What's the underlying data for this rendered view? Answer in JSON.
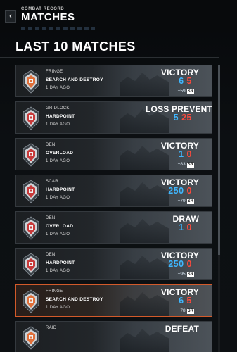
{
  "header": {
    "back_label": "‹",
    "breadcrumb": "COMBAT RECORD",
    "title": "MATCHES"
  },
  "section": {
    "title": "LAST 10 MATCHES"
  },
  "colors": {
    "blue_team": "#3fb7ff",
    "red_team": "#ff4a3d",
    "selection": "#d35a2a"
  },
  "matches": [
    {
      "map": "FRINGE",
      "mode": "SEARCH AND DESTROY",
      "time": "1 DAY AGO",
      "result": "VICTORY",
      "blue_score": "6",
      "red_score": "5",
      "sr_change": "+59",
      "sr_label": "SR",
      "emblem": "orange"
    },
    {
      "map": "GRIDLOCK",
      "mode": "HARDPOINT",
      "time": "1 DAY AGO",
      "result": "LOSS PREVENTED",
      "blue_score": "5",
      "red_score": "25",
      "sr_change": "",
      "sr_label": "",
      "emblem": "red"
    },
    {
      "map": "DEN",
      "mode": "OVERLOAD",
      "time": "1 DAY AGO",
      "result": "VICTORY",
      "blue_score": "1",
      "red_score": "0",
      "sr_change": "+83",
      "sr_label": "SR",
      "emblem": "red"
    },
    {
      "map": "SCAR",
      "mode": "HARDPOINT",
      "time": "1 DAY AGO",
      "result": "VICTORY",
      "blue_score": "250",
      "red_score": "0",
      "sr_change": "+79",
      "sr_label": "SR",
      "emblem": "red"
    },
    {
      "map": "DEN",
      "mode": "OVERLOAD",
      "time": "1 DAY AGO",
      "result": "DRAW",
      "blue_score": "1",
      "red_score": "0",
      "sr_change": "",
      "sr_label": "",
      "emblem": "red"
    },
    {
      "map": "DEN",
      "mode": "HARDPOINT",
      "time": "1 DAY AGO",
      "result": "VICTORY",
      "blue_score": "250",
      "red_score": "0",
      "sr_change": "+95",
      "sr_label": "SR",
      "emblem": "red"
    },
    {
      "map": "FRINGE",
      "mode": "SEARCH AND DESTROY",
      "time": "1 DAY AGO",
      "result": "VICTORY",
      "blue_score": "6",
      "red_score": "5",
      "sr_change": "+78",
      "sr_label": "SR",
      "emblem": "orange",
      "selected": true
    },
    {
      "map": "RAID",
      "mode": "",
      "time": "",
      "result": "DEFEAT",
      "blue_score": "",
      "red_score": "",
      "sr_change": "",
      "sr_label": "",
      "emblem": "orange"
    }
  ]
}
